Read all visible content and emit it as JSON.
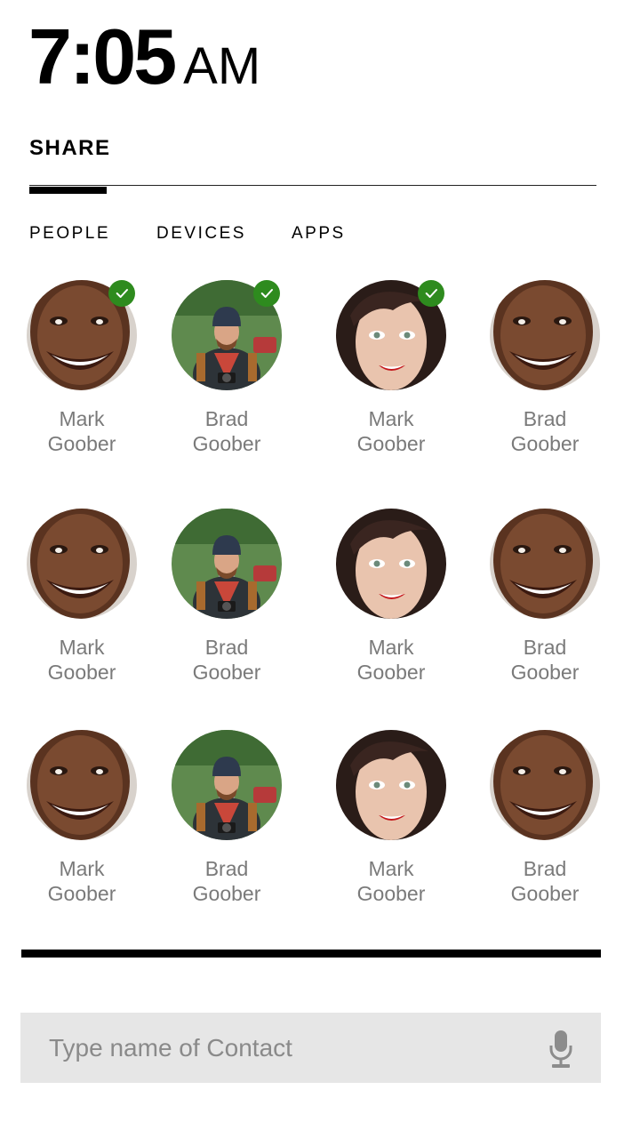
{
  "clock": {
    "time": "7:05",
    "ampm": "AM"
  },
  "share": {
    "title": "SHARE"
  },
  "tabs": [
    {
      "label": "PEOPLE",
      "active": true
    },
    {
      "label": "DEVICES",
      "active": false
    },
    {
      "label": "APPS",
      "active": false
    }
  ],
  "contacts": [
    {
      "first": "Mark",
      "last": "Goober",
      "avatar": "man-smiling",
      "selected": true
    },
    {
      "first": "Brad",
      "last": "Goober",
      "avatar": "man-camera",
      "selected": true
    },
    {
      "first": "Mark",
      "last": "Goober",
      "avatar": "woman-smiling",
      "selected": true
    },
    {
      "first": "Brad",
      "last": "Goober",
      "avatar": "man-smiling",
      "selected": false
    },
    {
      "first": "Mark",
      "last": "Goober",
      "avatar": "man-smiling",
      "selected": false
    },
    {
      "first": "Brad",
      "last": "Goober",
      "avatar": "man-camera",
      "selected": false
    },
    {
      "first": "Mark",
      "last": "Goober",
      "avatar": "woman-smiling",
      "selected": false
    },
    {
      "first": "Brad",
      "last": "Goober",
      "avatar": "man-smiling",
      "selected": false
    },
    {
      "first": "Mark",
      "last": "Goober",
      "avatar": "man-smiling",
      "selected": false
    },
    {
      "first": "Brad",
      "last": "Goober",
      "avatar": "man-camera",
      "selected": false
    },
    {
      "first": "Mark",
      "last": "Goober",
      "avatar": "woman-smiling",
      "selected": false
    },
    {
      "first": "Brad",
      "last": "Goober",
      "avatar": "man-smiling",
      "selected": false
    }
  ],
  "search": {
    "placeholder": "Type name of Contact",
    "value": "",
    "mic_icon": "microphone-icon"
  },
  "colors": {
    "check": "#2e8b1e",
    "name_text": "#7a7a7a",
    "search_bg": "#e6e6e6"
  }
}
